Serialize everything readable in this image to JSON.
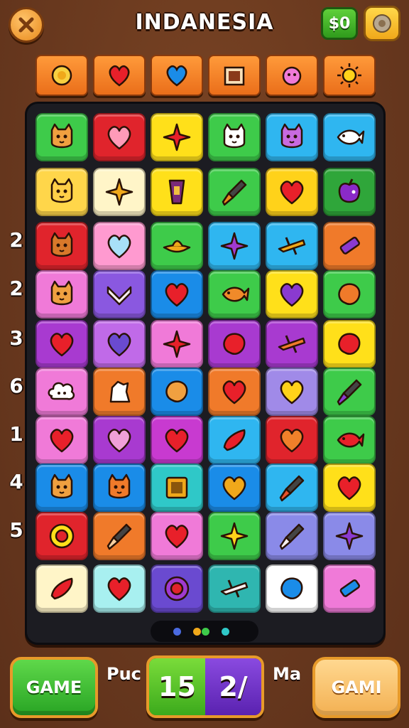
{
  "header": {
    "title": "INDANESIA",
    "money": "$0"
  },
  "categories": [
    {
      "icon": "lemon-icon"
    },
    {
      "icon": "heart-icon",
      "color": "#e8202a"
    },
    {
      "icon": "heart-icon",
      "color": "#1a8ce8"
    },
    {
      "icon": "picture-frame-icon"
    },
    {
      "icon": "sun-face-icon"
    },
    {
      "icon": "sun-icon"
    }
  ],
  "row_numbers": [
    "2",
    "2",
    "3",
    "6",
    "1",
    "4",
    "5"
  ],
  "board": {
    "rows": [
      [
        {
          "bg": "#3ecb4a",
          "icon": "cat"
        },
        {
          "bg": "#e0242c",
          "icon": "heart",
          "ic": "#ff9ab8"
        },
        {
          "bg": "#ffe01a",
          "icon": "star",
          "ic": "#e8202a"
        },
        {
          "bg": "#3ecb4a",
          "icon": "cat",
          "ic": "#ffffff"
        },
        {
          "bg": "#2fb6f0",
          "icon": "cat",
          "ic": "#c86ae0"
        },
        {
          "bg": "#2fb6f0",
          "icon": "fish",
          "ic": "#ffffff"
        }
      ],
      [
        {
          "bg": "#ffd64a",
          "icon": "cat",
          "ic": "#ffcf48"
        },
        {
          "bg": "#fff5c8",
          "icon": "star",
          "ic": "#f0a81a"
        },
        {
          "bg": "#ffe01a",
          "icon": "cup",
          "ic": "#7a2a7a"
        },
        {
          "bg": "#3ecb4a",
          "icon": "brush",
          "ic": "#e88a1c"
        },
        {
          "bg": "#ffd21a",
          "icon": "heart",
          "ic": "#e8202a"
        },
        {
          "bg": "#2fa63a",
          "icon": "apple",
          "ic": "#8a2ac8"
        }
      ],
      [
        {
          "bg": "#e0242c",
          "icon": "cat",
          "ic": "#d8782a"
        },
        {
          "bg": "#ff9ad0",
          "icon": "heart",
          "ic": "#a8e0f8"
        },
        {
          "bg": "#3ecb4a",
          "icon": "hat",
          "ic": "#f0a81a"
        },
        {
          "bg": "#2fb6f0",
          "icon": "star",
          "ic": "#a03ad0"
        },
        {
          "bg": "#2fb6f0",
          "icon": "plane",
          "ic": "#f0a81a"
        },
        {
          "bg": "#f07a2a",
          "icon": "tube",
          "ic": "#8a3ad0"
        }
      ],
      [
        {
          "bg": "#f07ad8",
          "icon": "cat",
          "ic": "#f0a040"
        },
        {
          "bg": "#8a58e0",
          "icon": "chevron",
          "ic": "#f8f0f0"
        },
        {
          "bg": "#1a8ce8",
          "icon": "heart",
          "ic": "#e8202a"
        },
        {
          "bg": "#3ecb4a",
          "icon": "fish",
          "ic": "#f08a2a"
        },
        {
          "bg": "#ffe01a",
          "icon": "heart",
          "ic": "#8a3ad0"
        },
        {
          "bg": "#3ecb4a",
          "icon": "blob",
          "ic": "#f07a2a"
        }
      ],
      [
        {
          "bg": "#a83ad0",
          "icon": "heart",
          "ic": "#e8202a"
        },
        {
          "bg": "#c06ae8",
          "icon": "heart",
          "ic": "#6a4ad0"
        },
        {
          "bg": "#f07ad8",
          "icon": "star",
          "ic": "#e8202a"
        },
        {
          "bg": "#a83ad0",
          "icon": "blob",
          "ic": "#e8202a"
        },
        {
          "bg": "#a83ad0",
          "icon": "plane",
          "ic": "#f07a2a"
        },
        {
          "bg": "#ffe01a",
          "icon": "blob",
          "ic": "#e8202a"
        }
      ],
      [
        {
          "bg": "#f07ad8",
          "icon": "cloud",
          "ic": "#ffffff"
        },
        {
          "bg": "#f07a2a",
          "icon": "dog",
          "ic": "#ffffff"
        },
        {
          "bg": "#1a8ce8",
          "icon": "blob",
          "ic": "#f0a040"
        },
        {
          "bg": "#f07a2a",
          "icon": "heart",
          "ic": "#e8202a"
        },
        {
          "bg": "#a08ae8",
          "icon": "heart",
          "ic": "#ffd21a"
        },
        {
          "bg": "#3ecb4a",
          "icon": "brush",
          "ic": "#8a3ad0"
        }
      ],
      [
        {
          "bg": "#f07ad8",
          "icon": "heart",
          "ic": "#e8202a"
        },
        {
          "bg": "#a83ad0",
          "icon": "heart",
          "ic": "#f0a0d8"
        },
        {
          "bg": "#c83ad0",
          "icon": "heart",
          "ic": "#e8202a"
        },
        {
          "bg": "#2fb6f0",
          "icon": "pepper",
          "ic": "#e8202a"
        },
        {
          "bg": "#e0242c",
          "icon": "heart",
          "ic": "#f0802a"
        },
        {
          "bg": "#3ecb4a",
          "icon": "fish",
          "ic": "#e8202a"
        }
      ],
      [
        {
          "bg": "#1a8ce8",
          "icon": "cat",
          "ic": "#f0a040"
        },
        {
          "bg": "#1a8ce8",
          "icon": "cat",
          "ic": "#f07a2a"
        },
        {
          "bg": "#2fc8c8",
          "icon": "box",
          "ic": "#f0a81a"
        },
        {
          "bg": "#1a8ce8",
          "icon": "heart",
          "ic": "#f0a81a"
        },
        {
          "bg": "#2fb6f0",
          "icon": "brush",
          "ic": "#e8502a"
        },
        {
          "bg": "#ffe01a",
          "icon": "heart",
          "ic": "#e8202a"
        }
      ],
      [
        {
          "bg": "#e0242c",
          "icon": "ring",
          "ic": "#ffe01a"
        },
        {
          "bg": "#f07a2a",
          "icon": "brush",
          "ic": "#f8d0a0"
        },
        {
          "bg": "#f07ad8",
          "icon": "heart",
          "ic": "#e8202a"
        },
        {
          "bg": "#3ecb4a",
          "icon": "star",
          "ic": "#ffd21a"
        },
        {
          "bg": "#8a8ae8",
          "icon": "brush",
          "ic": "#f8f0f0"
        },
        {
          "bg": "#8a8ae8",
          "icon": "star",
          "ic": "#8a3ad0"
        }
      ],
      [
        {
          "bg": "#fff5c8",
          "icon": "pepper",
          "ic": "#e8202a"
        },
        {
          "bg": "#a8f0f0",
          "icon": "heart",
          "ic": "#e8202a"
        },
        {
          "bg": "#6a4ad0",
          "icon": "ring",
          "ic": "#a03ad0"
        },
        {
          "bg": "#2fb6b0",
          "icon": "plane",
          "ic": "#f8f0f0"
        },
        {
          "bg": "#ffffff",
          "icon": "blob",
          "ic": "#1a8ce8"
        },
        {
          "bg": "#f07ad8",
          "icon": "tube",
          "ic": "#1a8ce8"
        }
      ]
    ]
  },
  "pager": {
    "dots": [
      "#4a6ae0",
      "#f0a81a",
      "#3ecb4a",
      "#2fc8c8"
    ]
  },
  "footer": {
    "left_button": "GAME",
    "label_left": "Puc",
    "score_left": "15",
    "score_right": "2/",
    "label_right": "Ma",
    "right_button": "GAMI"
  }
}
